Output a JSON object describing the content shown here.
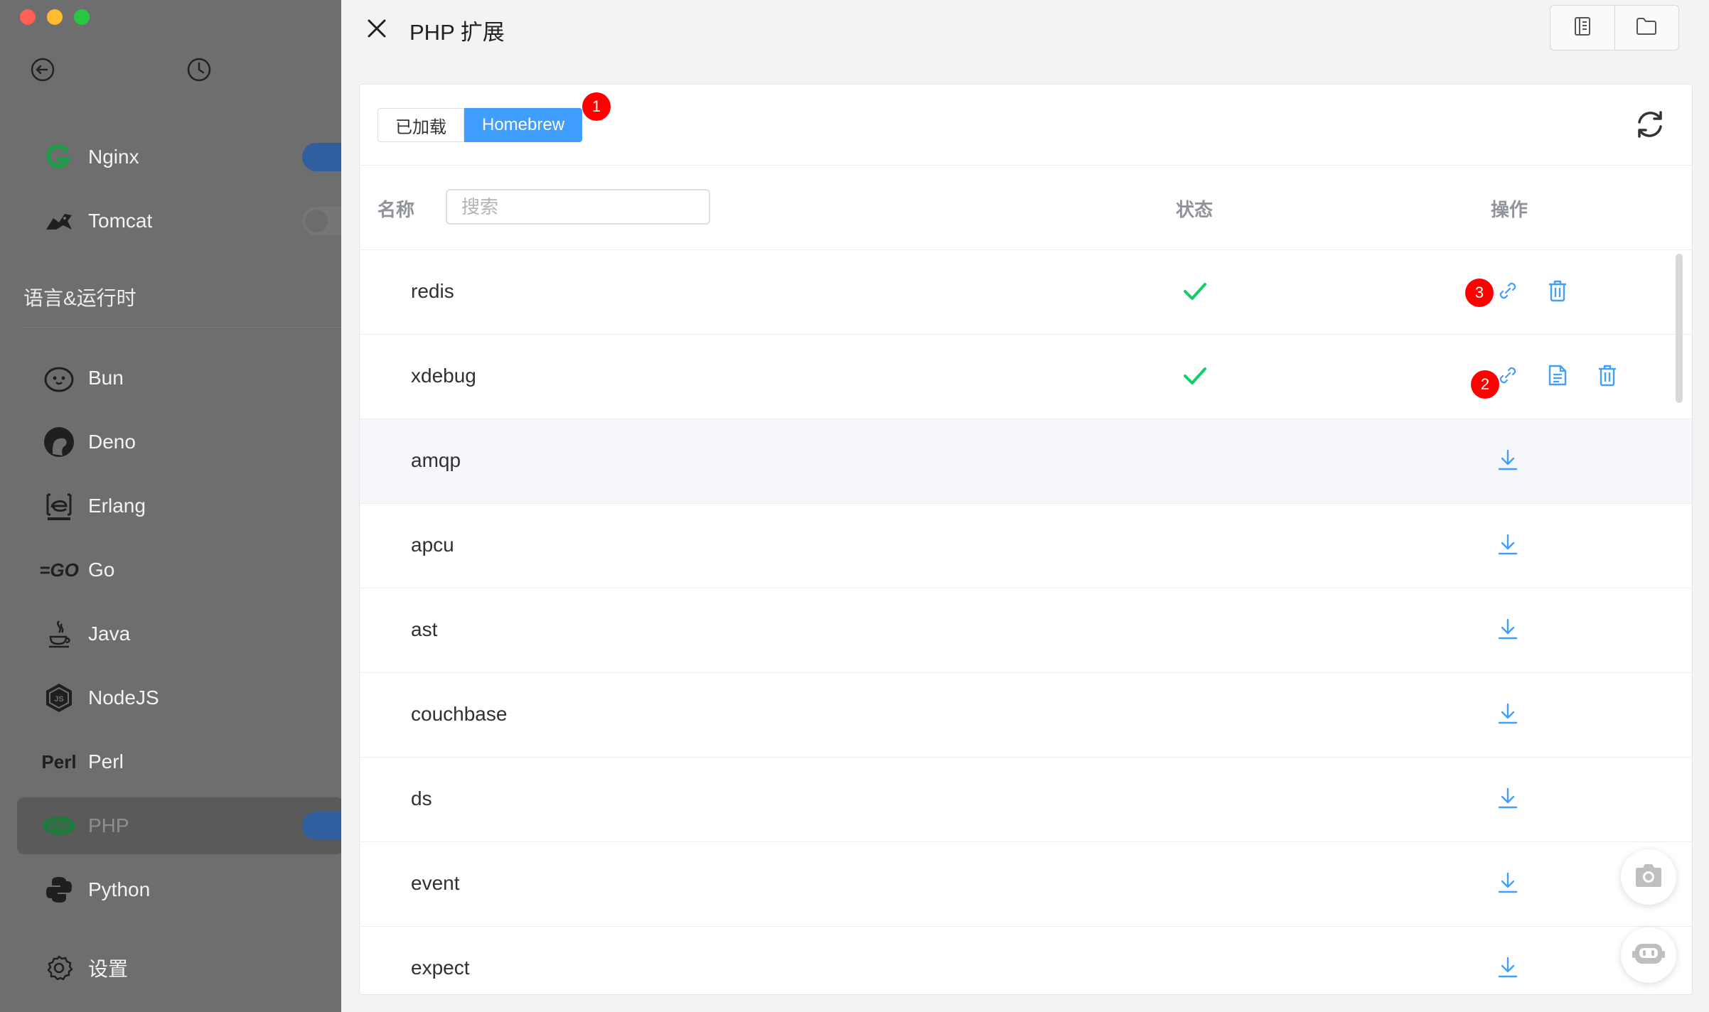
{
  "window": {
    "traffic_lights": [
      "#fe5f57",
      "#febc2e",
      "#28c840"
    ]
  },
  "sidebar": {
    "top_icons": [
      "back-icon",
      "history-icon"
    ],
    "services": [
      {
        "label": "Nginx",
        "icon": "nginx-icon",
        "toggle": "on"
      },
      {
        "label": "Tomcat",
        "icon": "tomcat-icon",
        "toggle": "off"
      }
    ],
    "section_title": "语言&运行时",
    "languages": [
      {
        "label": "Bun",
        "icon": "bun-icon"
      },
      {
        "label": "Deno",
        "icon": "deno-icon"
      },
      {
        "label": "Erlang",
        "icon": "erlang-icon"
      },
      {
        "label": "Go",
        "icon": "go-icon",
        "logo_text": "=GO"
      },
      {
        "label": "Java",
        "icon": "java-icon"
      },
      {
        "label": "NodeJS",
        "icon": "nodejs-icon"
      },
      {
        "label": "Perl",
        "icon": "perl-icon",
        "logo_text": "Perl"
      },
      {
        "label": "PHP",
        "icon": "php-icon",
        "logo_text": "php",
        "active": true,
        "toggle": "on"
      },
      {
        "label": "Python",
        "icon": "python-icon"
      }
    ],
    "settings_label": "设置"
  },
  "drawer": {
    "title": "PHP 扩展",
    "header_buttons": [
      "log-icon",
      "folder-icon"
    ],
    "tabs": [
      {
        "label": "已加载",
        "active": false
      },
      {
        "label": "Homebrew",
        "active": true
      }
    ],
    "annotations": {
      "tab_badge": "1",
      "xdebug_badge": "2",
      "redis_badge": "3"
    },
    "columns": {
      "name": "名称",
      "status": "状态",
      "actions": "操作"
    },
    "search": {
      "placeholder": "搜索",
      "value": ""
    },
    "rows": [
      {
        "name": "redis",
        "installed": true
      },
      {
        "name": "xdebug",
        "installed": true
      },
      {
        "name": "amqp",
        "installed": false
      },
      {
        "name": "apcu",
        "installed": false
      },
      {
        "name": "ast",
        "installed": false
      },
      {
        "name": "couchbase",
        "installed": false
      },
      {
        "name": "ds",
        "installed": false
      },
      {
        "name": "event",
        "installed": false
      },
      {
        "name": "expect",
        "installed": false
      }
    ],
    "floating_buttons": [
      "camera-icon",
      "robot-icon"
    ],
    "colors": {
      "accent": "#409eff",
      "success": "#13ce66",
      "badge": "#ff0000"
    }
  }
}
